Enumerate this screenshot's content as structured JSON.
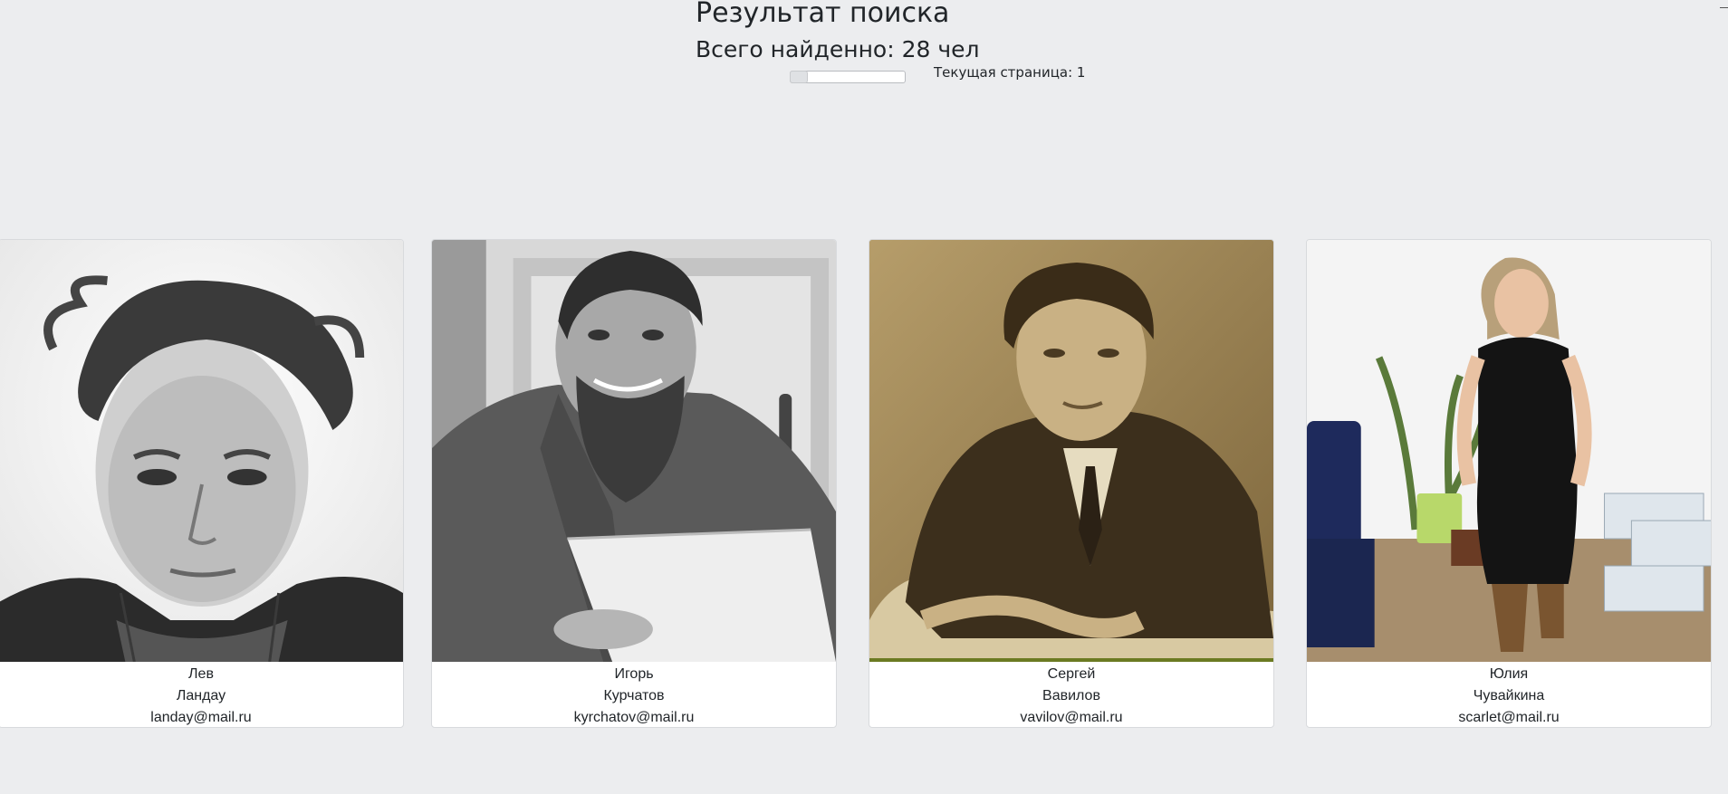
{
  "header": {
    "title": "Результат поиска",
    "total": "Всего найденно: 28 чел",
    "current_page": "Текущая страница: 1"
  },
  "pager_slider": {
    "value": 1,
    "min": 1
  },
  "cards": [
    {
      "first_name": "Лев",
      "last_name": "Ландау",
      "email": "landay@mail.ru"
    },
    {
      "first_name": "Игорь",
      "last_name": "Курчатов",
      "email": "kyrchatov@mail.ru"
    },
    {
      "first_name": "Сергей",
      "last_name": "Вавилов",
      "email": "vavilov@mail.ru"
    },
    {
      "first_name": "Юлия",
      "last_name": "Чувайкина",
      "email": "scarlet@mail.ru"
    }
  ],
  "icons": {
    "scroll_corner": "scroll-arrow-icon"
  },
  "colors": {
    "background": "#ecedef",
    "card": "#ffffff",
    "sepia_photo": "#6b5634"
  }
}
